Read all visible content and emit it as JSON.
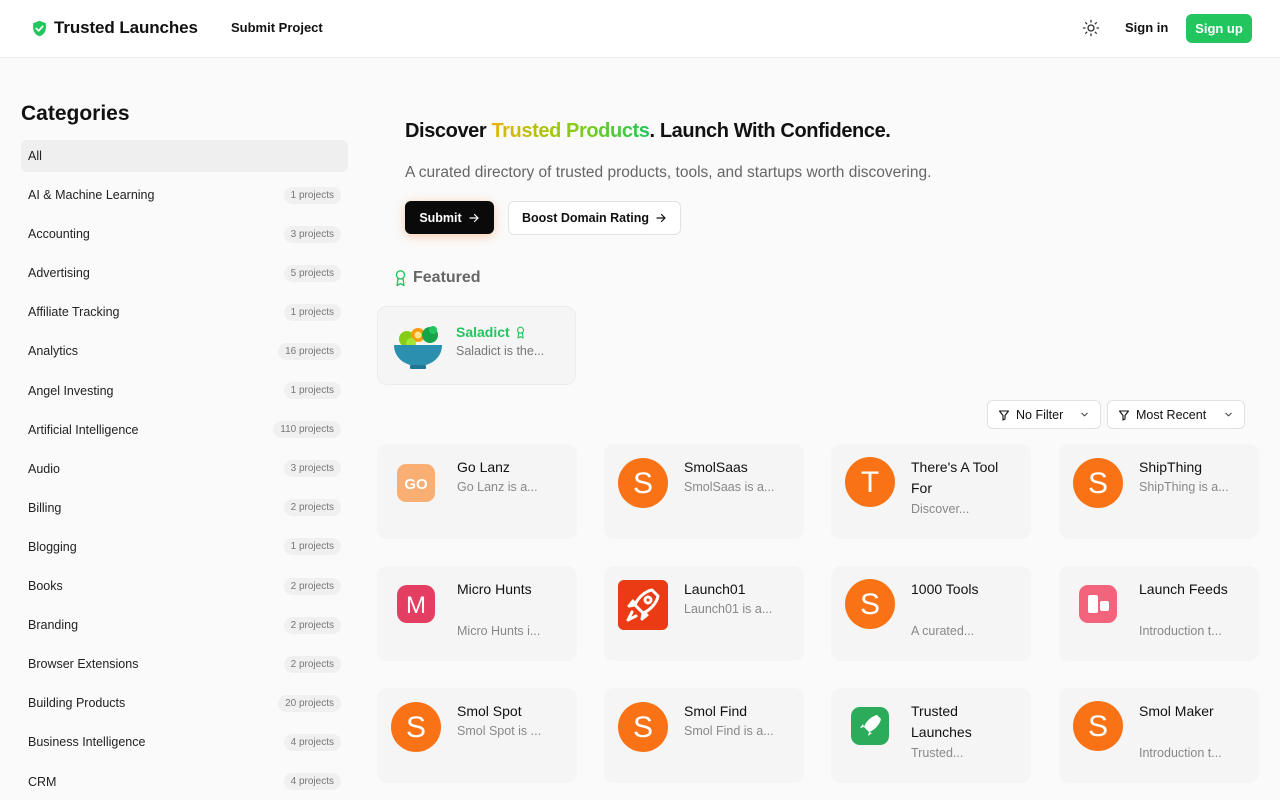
{
  "header": {
    "brand": "Trusted Launches",
    "nav_submit": "Submit Project",
    "sign_in": "Sign in",
    "sign_up": "Sign up"
  },
  "sidebar": {
    "title": "Categories",
    "categories": [
      {
        "label": "All",
        "count": ""
      },
      {
        "label": "AI & Machine Learning",
        "count": "1 projects"
      },
      {
        "label": "Accounting",
        "count": "3 projects"
      },
      {
        "label": "Advertising",
        "count": "5 projects"
      },
      {
        "label": "Affiliate Tracking",
        "count": "1 projects"
      },
      {
        "label": "Analytics",
        "count": "16 projects"
      },
      {
        "label": "Angel Investing",
        "count": "1 projects"
      },
      {
        "label": "Artificial Intelligence",
        "count": "110 projects"
      },
      {
        "label": "Audio",
        "count": "3 projects"
      },
      {
        "label": "Billing",
        "count": "2 projects"
      },
      {
        "label": "Blogging",
        "count": "1 projects"
      },
      {
        "label": "Books",
        "count": "2 projects"
      },
      {
        "label": "Branding",
        "count": "2 projects"
      },
      {
        "label": "Browser Extensions",
        "count": "2 projects"
      },
      {
        "label": "Building Products",
        "count": "20 projects"
      },
      {
        "label": "Business Intelligence",
        "count": "4 projects"
      },
      {
        "label": "CRM",
        "count": "4 projects"
      }
    ]
  },
  "hero": {
    "title_start": "Discover ",
    "title_highlight": "Trusted Products",
    "title_end": ". Launch With Confidence.",
    "subtitle": "A curated directory of trusted products, tools, and startups worth discovering.",
    "submit_label": "Submit",
    "boost_label": "Boost Domain Rating"
  },
  "featured": {
    "title": "Featured",
    "item": {
      "name": "Saladict",
      "desc": "Saladict is the..."
    }
  },
  "filters": {
    "filter_label": "No Filter",
    "sort_label": "Most Recent"
  },
  "products": [
    {
      "name": "Go Lanz",
      "desc": "Go Lanz is a...",
      "logo": "golanz-logo"
    },
    {
      "name": "SmolSaas",
      "desc": "SmolSaas is a...",
      "logo": "s-logo"
    },
    {
      "name": "There's A Tool For",
      "desc": "Discover...",
      "logo": "t-logo"
    },
    {
      "name": "ShipThing",
      "desc": "ShipThing is a...",
      "logo": "s-logo"
    },
    {
      "name": "Micro Hunts",
      "desc": "Micro Hunts i...",
      "logo": "m-logo"
    },
    {
      "name": "Launch01",
      "desc": "Launch01 is a...",
      "logo": "rocket-logo"
    },
    {
      "name": "1000 Tools",
      "desc": "A curated...",
      "logo": "s-logo"
    },
    {
      "name": "Launch Feeds",
      "desc": "Introduction t...",
      "logo": "launchfeeds-logo"
    },
    {
      "name": "Smol Spot",
      "desc": "Smol Spot is ...",
      "logo": "s-logo"
    },
    {
      "name": "Smol Find",
      "desc": "Smol Find is a...",
      "logo": "s-logo"
    },
    {
      "name": "Trusted Launches",
      "desc": "Trusted...",
      "logo": "trusted-logo"
    },
    {
      "name": "Smol Maker",
      "desc": "Introduction t...",
      "logo": "s-logo"
    }
  ],
  "colors": {
    "accent": "#22c55e",
    "smol_orange": "#f97316",
    "submit_bg": "#0a0a0a"
  }
}
